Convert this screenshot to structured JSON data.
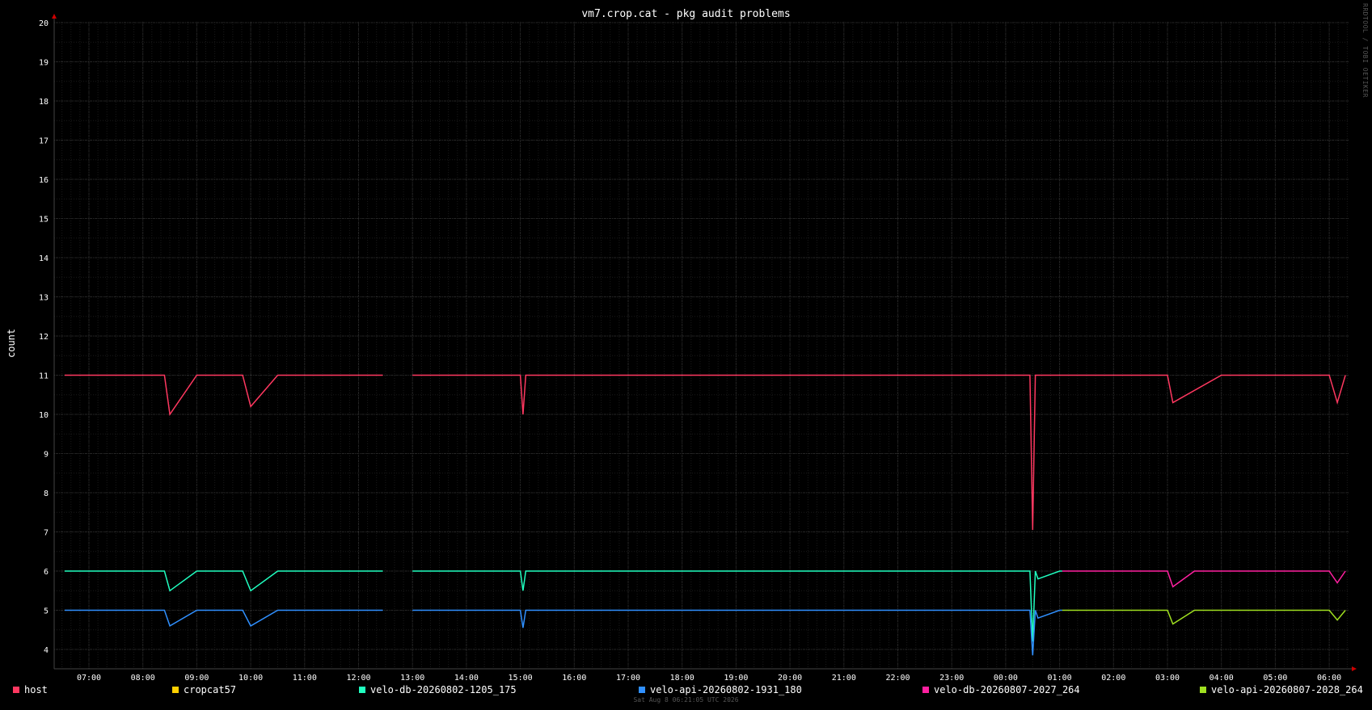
{
  "chart_data": {
    "type": "line",
    "title": "vm7.crop.cat - pkg audit problems",
    "ylabel": "count",
    "xlabel": "",
    "ylim": [
      3.5,
      20
    ],
    "y_ticks": [
      4,
      5,
      6,
      7,
      8,
      9,
      10,
      11,
      12,
      13,
      14,
      15,
      16,
      17,
      18,
      19,
      20
    ],
    "x_ticks": [
      "07:00",
      "08:00",
      "09:00",
      "10:00",
      "11:00",
      "12:00",
      "13:00",
      "14:00",
      "15:00",
      "16:00",
      "17:00",
      "18:00",
      "19:00",
      "20:00",
      "21:00",
      "22:00",
      "23:00",
      "00:00",
      "01:00",
      "02:00",
      "03:00",
      "04:00",
      "05:00",
      "06:00"
    ],
    "grid": true,
    "legend_placement": "bottom",
    "series": [
      {
        "name": "host",
        "color": "#ff3860",
        "segments": [
          {
            "x": [
              6.55,
              7.0,
              7.5,
              8.0,
              8.4,
              8.5,
              9.0,
              9.5,
              9.85,
              10.0,
              10.5,
              10.8,
              11.0,
              11.5,
              12.0,
              12.45
            ],
            "y": [
              11,
              11,
              11,
              11,
              11,
              10,
              11,
              11,
              11,
              10.2,
              11,
              11,
              11,
              11,
              11,
              11
            ]
          },
          {
            "x": [
              13.0,
              14.0,
              15.0,
              15.05,
              15.1,
              16.0,
              20.0,
              23.1,
              24.0,
              24.45,
              24.5,
              24.55,
              25.0,
              26.0,
              27.0,
              27.1,
              28.0,
              29.0,
              30.0,
              30.15,
              30.3
            ],
            "y": [
              11,
              11,
              11,
              10,
              11,
              11,
              11,
              11,
              11,
              11,
              7.05,
              11,
              11,
              11,
              11,
              10.3,
              11,
              11,
              11,
              10.3,
              11
            ]
          }
        ]
      },
      {
        "name": "cropcat57",
        "color": "#ffd000",
        "segments": []
      },
      {
        "name": "velo-db-20260802-1205_175",
        "color": "#20ffc0",
        "segments": [
          {
            "x": [
              6.55,
              7.0,
              7.5,
              8.0,
              8.4,
              8.5,
              9.0,
              9.5,
              9.85,
              10.0,
              10.5,
              11.0,
              11.5,
              12.0,
              12.45
            ],
            "y": [
              6,
              6,
              6,
              6,
              6,
              5.5,
              6,
              6,
              6,
              5.5,
              6,
              6,
              6,
              6,
              6
            ]
          },
          {
            "x": [
              13.0,
              14.0,
              15.0,
              15.05,
              15.1,
              16.0,
              20.0,
              23.1,
              24.0,
              24.45,
              24.5,
              24.55,
              24.6,
              25.0,
              25.05
            ],
            "y": [
              6,
              6,
              6,
              5.5,
              6,
              6,
              6,
              6,
              6,
              6,
              4.2,
              6,
              5.8,
              6,
              6
            ]
          }
        ]
      },
      {
        "name": "velo-api-20260802-1931_180",
        "color": "#3090ff",
        "segments": [
          {
            "x": [
              6.55,
              7.0,
              7.5,
              8.0,
              8.4,
              8.5,
              9.0,
              9.5,
              9.85,
              10.0,
              10.5,
              11.0,
              11.5,
              12.0,
              12.45
            ],
            "y": [
              5,
              5,
              5,
              5,
              5,
              4.6,
              5,
              5,
              5,
              4.6,
              5,
              5,
              5,
              5,
              5
            ]
          },
          {
            "x": [
              13.0,
              14.0,
              15.0,
              15.05,
              15.1,
              16.0,
              20.0,
              23.1,
              24.0,
              24.45,
              24.5,
              24.55,
              24.6,
              25.0,
              25.05
            ],
            "y": [
              5,
              5,
              5,
              4.55,
              5,
              5,
              5,
              5,
              5,
              5,
              3.85,
              5,
              4.8,
              5,
              5
            ]
          }
        ]
      },
      {
        "name": "velo-db-20260807-2027_264",
        "color": "#ff20a0",
        "segments": [
          {
            "x": [
              25.05,
              25.5,
              26.0,
              26.5,
              27.0,
              27.1,
              27.5,
              28.0,
              28.5,
              29.0,
              29.5,
              30.0,
              30.15,
              30.3
            ],
            "y": [
              6,
              6,
              6,
              6,
              6,
              5.6,
              6,
              6,
              6,
              6,
              6,
              6,
              5.7,
              6
            ]
          }
        ]
      },
      {
        "name": "velo-api-20260807-2028_264",
        "color": "#a0e020",
        "segments": [
          {
            "x": [
              25.05,
              25.5,
              26.0,
              26.5,
              27.0,
              27.1,
              27.5,
              28.0,
              28.5,
              29.0,
              29.5,
              30.0,
              30.15,
              30.3
            ],
            "y": [
              5,
              5,
              5,
              5,
              5,
              4.65,
              5,
              5,
              5,
              5,
              5,
              5,
              4.75,
              5
            ]
          }
        ]
      }
    ]
  },
  "footer_text": "Sat Aug  8 06:21:05 UTC 2026",
  "watermark_text": "RRDTOOL / TOBI OETIKER"
}
